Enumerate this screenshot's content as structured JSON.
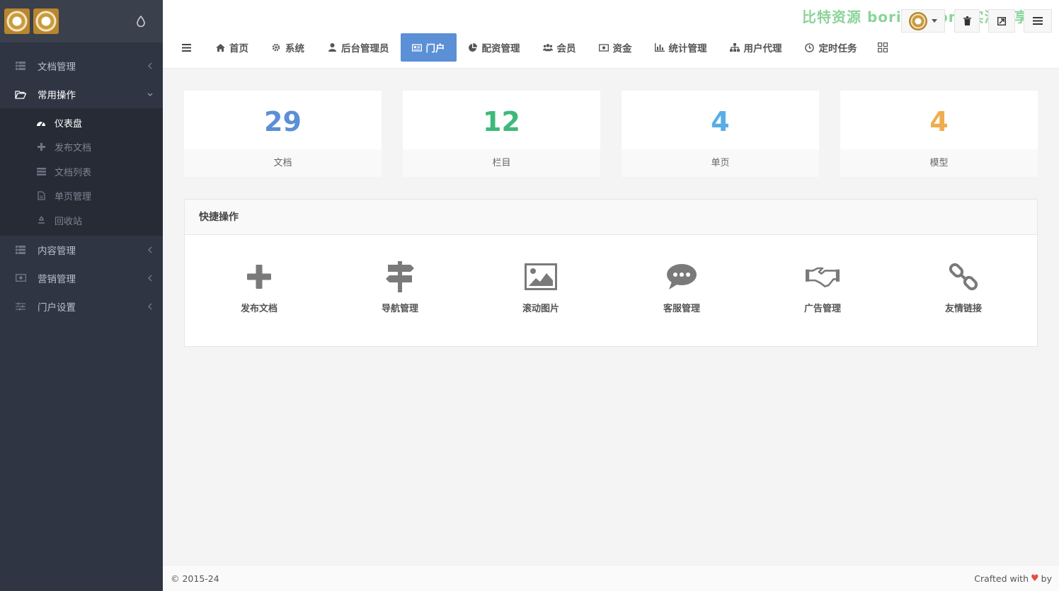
{
  "sidebar": {
    "items": [
      {
        "label": "文档管理",
        "icon": "list-icon"
      },
      {
        "label": "常用操作",
        "icon": "folder-open-icon"
      },
      {
        "label": "内容管理",
        "icon": "list-icon"
      },
      {
        "label": "营销管理",
        "icon": "money-icon"
      },
      {
        "label": "门户设置",
        "icon": "sliders-icon"
      }
    ],
    "submenu": [
      {
        "label": "仪表盘",
        "icon": "dashboard-icon"
      },
      {
        "label": "发布文档",
        "icon": "plus-icon"
      },
      {
        "label": "文档列表",
        "icon": "list-icon"
      },
      {
        "label": "单页管理",
        "icon": "file-icon"
      },
      {
        "label": "回收站",
        "icon": "recycle-icon"
      }
    ]
  },
  "topbar": {
    "watermark": "比特资源 bori99.com 实测分享",
    "tabs": [
      {
        "label": "首页",
        "icon": "home-icon"
      },
      {
        "label": "系统",
        "icon": "gear-icon"
      },
      {
        "label": "后台管理员",
        "icon": "user-icon"
      },
      {
        "label": "门户",
        "icon": "newspaper-icon"
      },
      {
        "label": "配资管理",
        "icon": "pie-chart-icon"
      },
      {
        "label": "会员",
        "icon": "users-icon"
      },
      {
        "label": "资金",
        "icon": "money-icon"
      },
      {
        "label": "统计管理",
        "icon": "bar-chart-icon"
      },
      {
        "label": "用户代理",
        "icon": "sitemap-icon"
      },
      {
        "label": "定时任务",
        "icon": "clock-icon"
      }
    ]
  },
  "stats": [
    {
      "value": "29",
      "label": "文档",
      "color": "#5b8fd6"
    },
    {
      "value": "12",
      "label": "栏目",
      "color": "#3fb97a"
    },
    {
      "value": "4",
      "label": "单页",
      "color": "#5aaee6"
    },
    {
      "value": "4",
      "label": "模型",
      "color": "#f0ad4e"
    }
  ],
  "quick": {
    "title": "快捷操作",
    "items": [
      {
        "label": "发布文档",
        "icon": "plus-icon"
      },
      {
        "label": "导航管理",
        "icon": "signpost-icon"
      },
      {
        "label": "滚动图片",
        "icon": "image-icon"
      },
      {
        "label": "客服管理",
        "icon": "chat-icon"
      },
      {
        "label": "广告管理",
        "icon": "handshake-icon"
      },
      {
        "label": "友情链接",
        "icon": "link-icon"
      }
    ]
  },
  "footer": {
    "left": "© 2015-24",
    "right_prefix": "Crafted with",
    "heart": "♥",
    "right_suffix": "by"
  },
  "colors": {
    "sidebar": "#2f3542",
    "accent": "#5b8fd6",
    "background": "#f4f4f4"
  }
}
